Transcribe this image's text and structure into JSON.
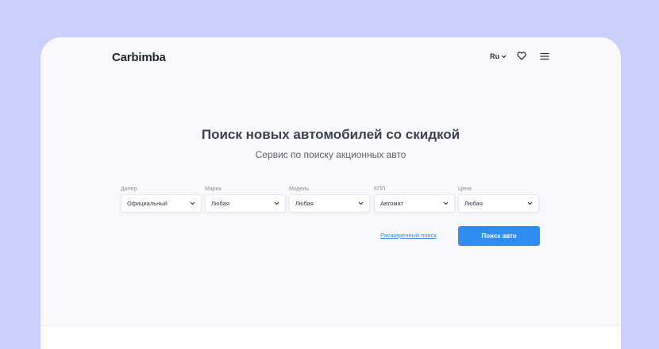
{
  "header": {
    "logo": "Carbimba",
    "language": "Ru"
  },
  "hero": {
    "title": "Поиск новых автомобилей со скидкой",
    "subtitle": "Сервис по поиску акционных авто"
  },
  "filters": [
    {
      "label": "Дилер",
      "value": "Официальный"
    },
    {
      "label": "Марка",
      "value": "Любая"
    },
    {
      "label": "Модель",
      "value": "Любая"
    },
    {
      "label": "КПП",
      "value": "Автомат"
    },
    {
      "label": "Цена",
      "value": "Любая"
    }
  ],
  "actions": {
    "advanced_link": "Расширенный поиск",
    "search_button": "Поиск авто"
  },
  "colors": {
    "background": "#c9d0fe",
    "accent": "#2f8ef0",
    "link": "#3d8de0"
  }
}
